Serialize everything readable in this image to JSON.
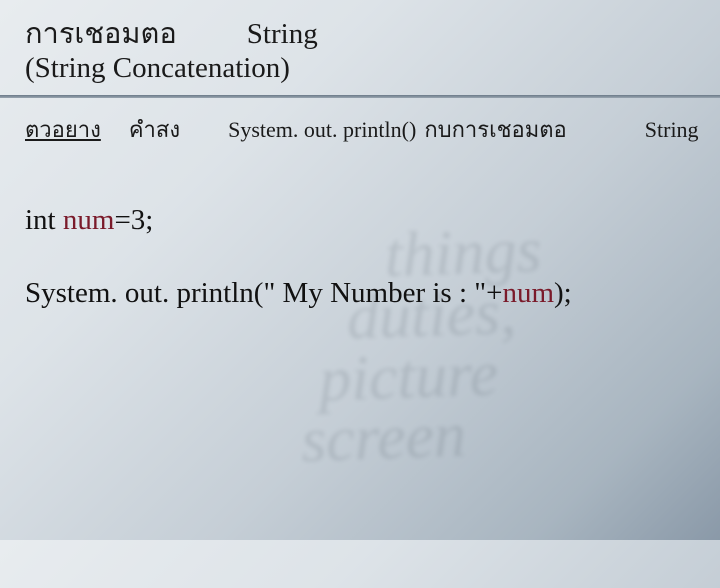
{
  "title": {
    "thai": "การเชอมตอ",
    "eng": "String"
  },
  "subtitle": "(String Concatenation)",
  "example": {
    "label": "ตวอยาง",
    "command": "คำสง",
    "method": "System. out. println()",
    "thai_mid": "กบการเชอมตอ",
    "trailing": "String"
  },
  "code": {
    "line1_kw": "int  ",
    "line1_var": "num",
    "line1_rest": "=3;",
    "line2_pre": "System. out. println(",
    "line2_str": "\" My Number is : \"",
    "line2_plus": "+",
    "line2_var": "num",
    "line2_end": ");"
  },
  "bgwords": {
    "w1": "things",
    "w2": "duties,",
    "w3": "picture",
    "w4": "screen"
  }
}
